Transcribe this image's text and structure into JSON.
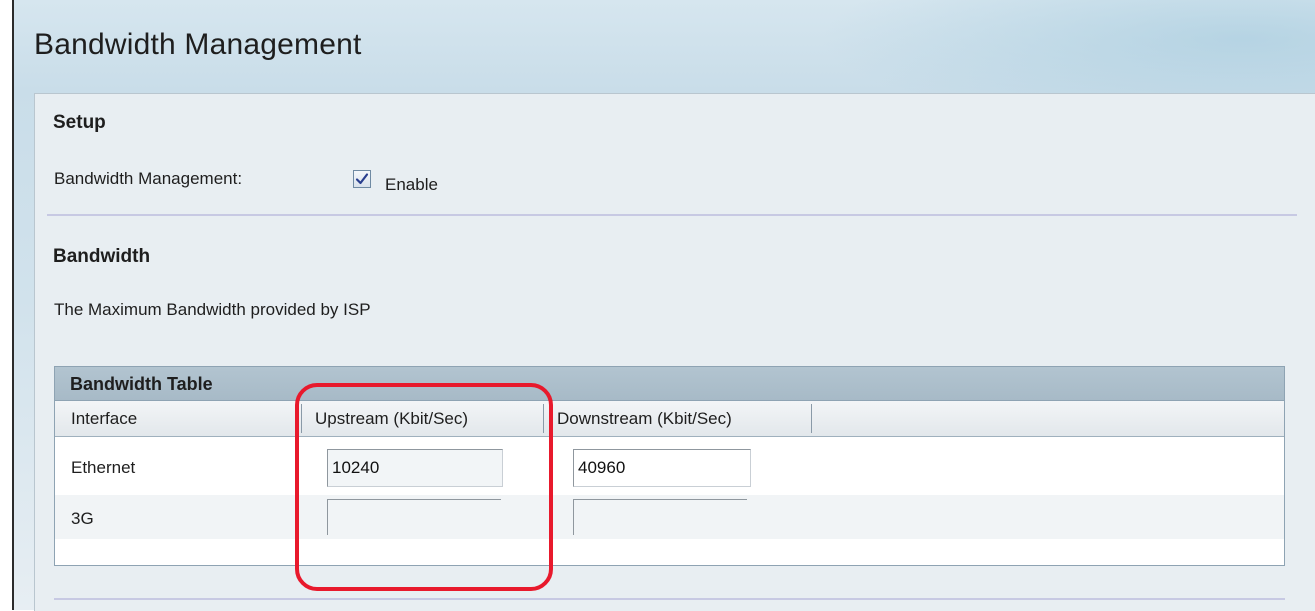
{
  "page": {
    "title": "Bandwidth Management"
  },
  "setup": {
    "heading": "Setup",
    "bm_label": "Bandwidth Management:",
    "enable_label": "Enable",
    "enable_checked": true
  },
  "bandwidth": {
    "heading": "Bandwidth",
    "description": "The Maximum Bandwidth provided by ISP"
  },
  "table": {
    "title": "Bandwidth Table",
    "columns": [
      "Interface",
      "Upstream (Kbit/Sec)",
      "Downstream (Kbit/Sec)"
    ],
    "rows": [
      {
        "interface": "Ethernet",
        "upstream": "10240",
        "downstream": "40960"
      },
      {
        "interface": "3G",
        "upstream": "",
        "downstream": ""
      }
    ]
  },
  "colors": {
    "highlight": "#e8192c",
    "table_header": "#a7bac7",
    "divider": "#c7c9e3"
  }
}
